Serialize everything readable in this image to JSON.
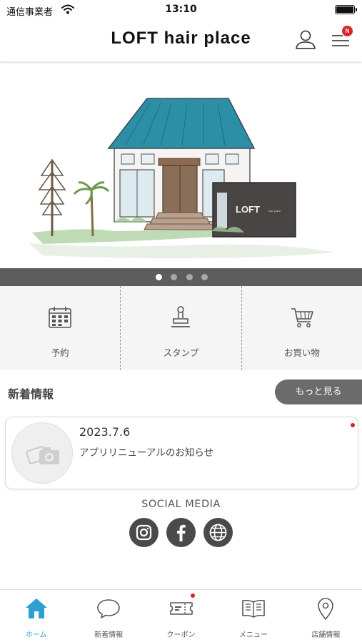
{
  "status_bar": {
    "carrier": "通信事業者",
    "time": "13:10",
    "battery_level": 1.0
  },
  "header": {
    "title": "LOFT hair place",
    "menu_badge": "N"
  },
  "hero": {
    "sign_text": "LOFT",
    "sign_subtext": "hair place",
    "slide_count": 4,
    "active_slide": 0
  },
  "quick_menu": [
    {
      "label": "予約",
      "icon": "calendar-icon"
    },
    {
      "label": "スタンプ",
      "icon": "stamp-icon"
    },
    {
      "label": "お買い物",
      "icon": "cart-icon"
    }
  ],
  "news": {
    "section_title": "新着情報",
    "more_label": "もっと見る",
    "items": [
      {
        "date": "2023.7.6",
        "title": "アプリリニューアルのお知らせ",
        "unread": true
      }
    ]
  },
  "social": {
    "title": "SOCIAL MEDIA",
    "links": [
      {
        "icon": "instagram-icon"
      },
      {
        "icon": "facebook-icon"
      },
      {
        "icon": "globe-icon"
      }
    ]
  },
  "tab_bar": [
    {
      "label": "ホーム",
      "icon": "home-icon",
      "active": true
    },
    {
      "label": "新着情報",
      "icon": "chat-bubble-icon"
    },
    {
      "label": "クーポン",
      "icon": "ticket-icon",
      "badge": true
    },
    {
      "label": "メニュー",
      "icon": "book-icon"
    },
    {
      "label": "店舗情報",
      "icon": "location-pin-icon"
    }
  ],
  "colors": {
    "accent": "#2f9fd3",
    "badge": "#d9232a",
    "pager_bg": "#5d5d5d",
    "roof": "#2c8fa6"
  }
}
